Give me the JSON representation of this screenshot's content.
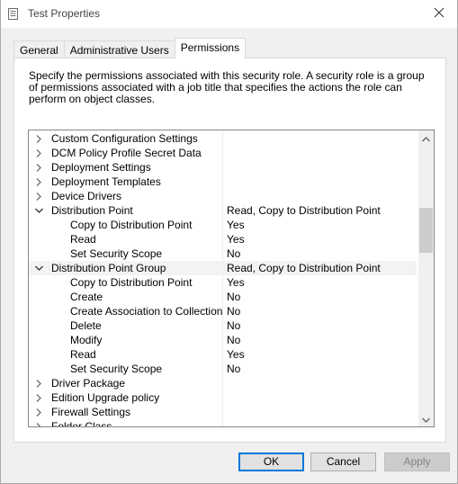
{
  "window": {
    "title": "Test Properties",
    "title_icon": "properties-sheet-icon",
    "close_icon": "close-icon"
  },
  "tabs": [
    {
      "label": "General",
      "active": false
    },
    {
      "label": "Administrative Users",
      "active": false
    },
    {
      "label": "Permissions",
      "active": true
    }
  ],
  "description": "Specify the permissions associated with this security role. A security role is a group of permissions associated with a job title that specifies the actions the role can perform on object classes.",
  "tree": {
    "rows": [
      {
        "name": "Custom Configuration Settings",
        "value": "",
        "level": 0,
        "expander": "chevron-right-icon"
      },
      {
        "name": "DCM Policy Profile Secret Data",
        "value": "",
        "level": 0,
        "expander": "chevron-right-icon"
      },
      {
        "name": "Deployment Settings",
        "value": "",
        "level": 0,
        "expander": "chevron-right-icon"
      },
      {
        "name": "Deployment Templates",
        "value": "",
        "level": 0,
        "expander": "chevron-right-icon"
      },
      {
        "name": "Device Drivers",
        "value": "",
        "level": 0,
        "expander": "chevron-right-icon"
      },
      {
        "name": "Distribution Point",
        "value": "Read, Copy to Distribution Point",
        "level": 0,
        "expander": "chevron-down-icon"
      },
      {
        "name": "Copy to Distribution Point",
        "value": "Yes",
        "level": 1,
        "expander": ""
      },
      {
        "name": "Read",
        "value": "Yes",
        "level": 1,
        "expander": ""
      },
      {
        "name": "Set Security Scope",
        "value": "No",
        "level": 1,
        "expander": ""
      },
      {
        "name": "Distribution Point Group",
        "value": "Read, Copy to Distribution Point",
        "level": 0,
        "expander": "chevron-down-icon",
        "selected": true
      },
      {
        "name": "Copy to Distribution Point",
        "value": "Yes",
        "level": 1,
        "expander": ""
      },
      {
        "name": "Create",
        "value": "No",
        "level": 1,
        "expander": ""
      },
      {
        "name": "Create Association to Collection",
        "value": "No",
        "level": 1,
        "expander": ""
      },
      {
        "name": "Delete",
        "value": "No",
        "level": 1,
        "expander": ""
      },
      {
        "name": "Modify",
        "value": "No",
        "level": 1,
        "expander": ""
      },
      {
        "name": "Read",
        "value": "Yes",
        "level": 1,
        "expander": ""
      },
      {
        "name": "Set Security Scope",
        "value": "No",
        "level": 1,
        "expander": ""
      },
      {
        "name": "Driver Package",
        "value": "",
        "level": 0,
        "expander": "chevron-right-icon"
      },
      {
        "name": "Edition Upgrade policy",
        "value": "",
        "level": 0,
        "expander": "chevron-right-icon"
      },
      {
        "name": "Firewall Settings",
        "value": "",
        "level": 0,
        "expander": "chevron-right-icon"
      },
      {
        "name": "Folder Class",
        "value": "",
        "level": 0,
        "expander": "chevron-right-icon"
      }
    ],
    "scroll_position": 0.45
  },
  "buttons": {
    "ok": "OK",
    "cancel": "Cancel",
    "apply": "Apply"
  },
  "colors": {
    "accent": "#0078d7",
    "selected_row": "#f3f3f3"
  }
}
